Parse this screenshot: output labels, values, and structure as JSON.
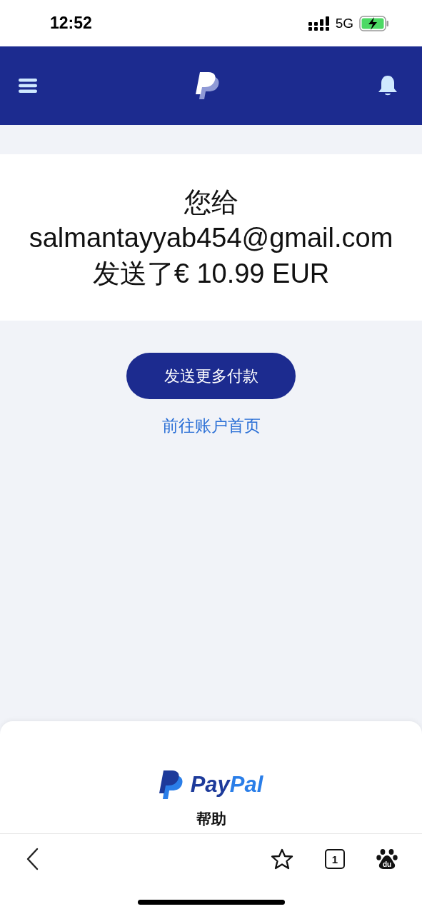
{
  "status_bar": {
    "time": "12:52",
    "network": "5G"
  },
  "confirmation": {
    "message": "您给 salmantayyab454@gmail.com 发送了€ 10.99 EUR"
  },
  "actions": {
    "primary_button": "发送更多付款",
    "link": "前往账户首页"
  },
  "footer": {
    "wordmark": {
      "first": "Pay",
      "second": "Pal"
    },
    "help": "帮助"
  },
  "toolbar": [
    {
      "kind": "back"
    },
    {
      "kind": "star"
    },
    {
      "kind": "tabs",
      "label": "1"
    },
    {
      "kind": "baidu",
      "label": "du"
    }
  ]
}
